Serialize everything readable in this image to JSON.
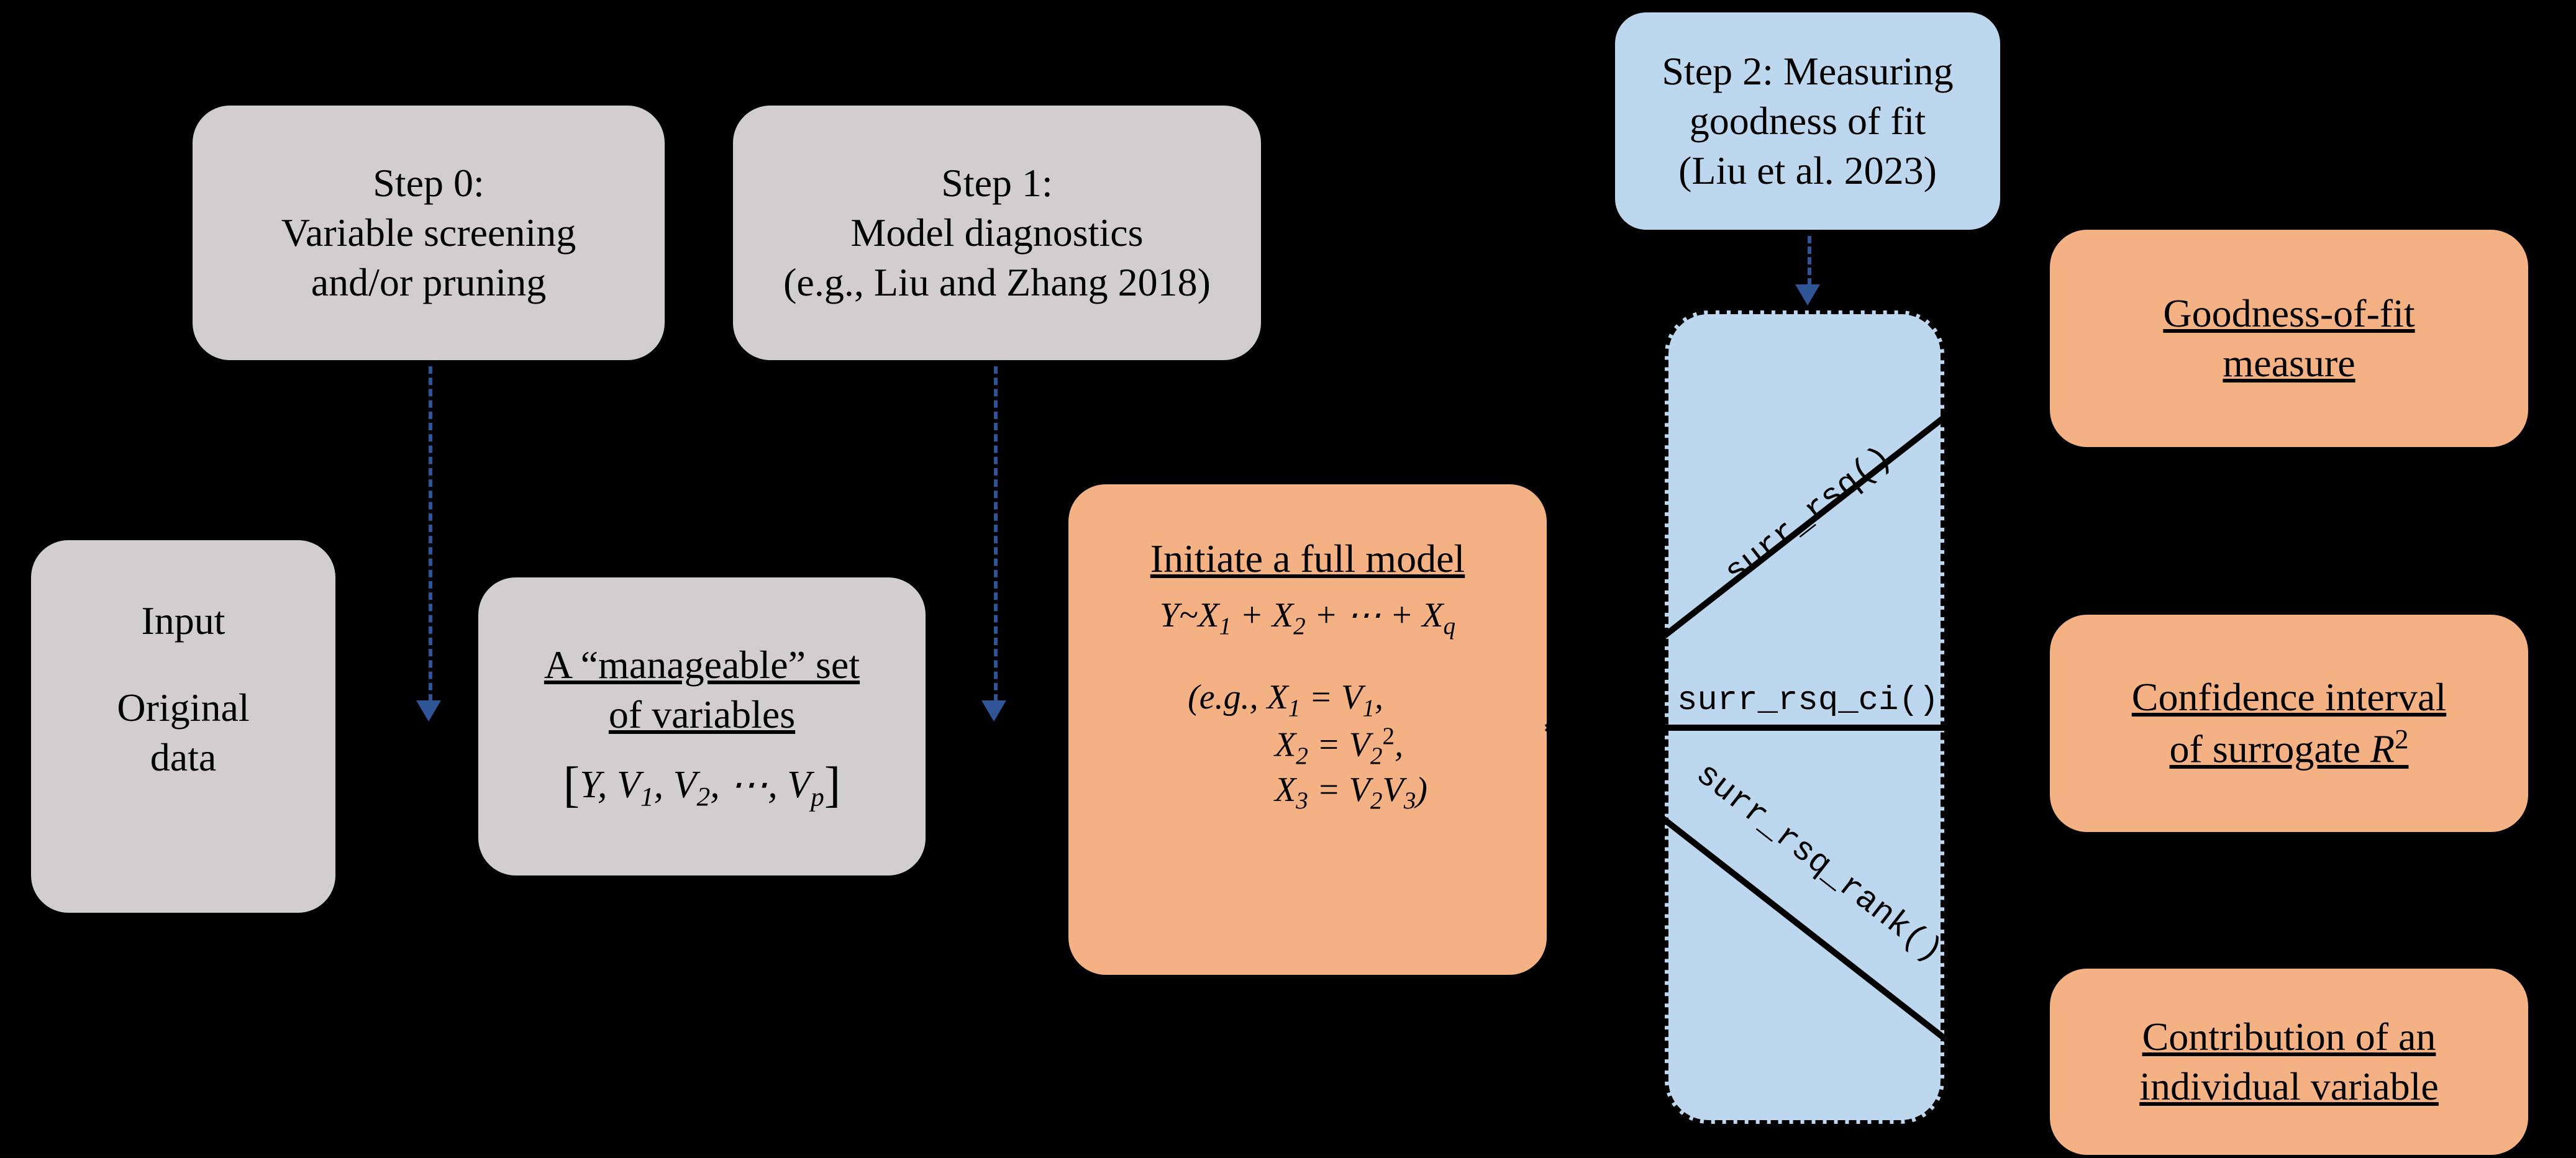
{
  "step0": {
    "title": "Step 0:",
    "desc1": "Variable screening",
    "desc2": "and/or pruning"
  },
  "step1": {
    "title": "Step 1:",
    "desc1": "Model diagnostics",
    "desc2": "(e.g., Liu and Zhang 2018)"
  },
  "step2": {
    "line1": "Step 2: Measuring",
    "line2": "goodness of fit",
    "line3": "(Liu et al. 2023)"
  },
  "input": {
    "title": "Input",
    "sub1": "Original",
    "sub2": "data"
  },
  "vars": {
    "line1": "A “manageable” set",
    "line2": "of variables"
  },
  "fullmodel": {
    "title": "Initiate a full model"
  },
  "funcs": {
    "rsq": "surr_rsq()",
    "ci": "surr_rsq_ci()",
    "rank": "surr_rsq_rank()"
  },
  "out": {
    "gof1": "Goodness-of-fit",
    "gof2": "measure",
    "ci1": "Confidence interval",
    "ci2_a": "of surrogate ",
    "ci2_b": "R",
    "ci2_c": "2",
    "contrib1": "Contribution of an",
    "contrib2": "individual variable"
  }
}
